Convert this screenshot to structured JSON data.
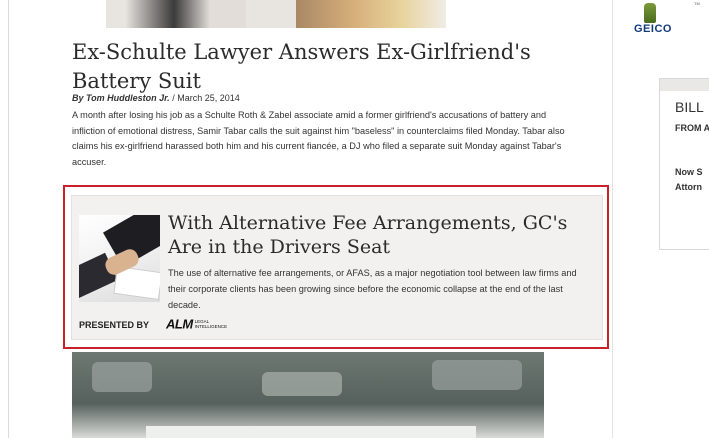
{
  "article": {
    "headline": "Ex-Schulte Lawyer Answers Ex-Girlfriend's Battery Suit",
    "author": "By Tom Huddleston Jr.",
    "date": "/ March 25, 2014",
    "summary": "A month after losing his job as a Schulte Roth & Zabel associate amid a former girlfriend's accusations of battery and infliction of emotional distress, Samir Tabar calls the suit against him \"baseless\" in counterclaims filed Monday. Tabar also claims his ex-girlfriend harassed both him and his current fiancée, a DJ who filed a separate suit Monday against Tabar's accuser."
  },
  "promo": {
    "title": "With Alternative Fee Arrangements, GC's Are in the Drivers Seat",
    "description": "The use of alternative fee arrangements, or AFAS, as a major negotiation tool between law firms and their corporate clients has been growing since before the economic collapse at the end of the last decade.",
    "presented_by": "PRESENTED BY",
    "sponsor_logo_main": "ALM",
    "sponsor_logo_sub": "LEGAL INTELLIGENCE",
    "highlight_color": "#c9202a"
  },
  "sidebar": {
    "ad_brand": "GEICO",
    "ad_mark": "TM",
    "box_title": "BILL",
    "box_subtitle": "FROM A",
    "box_line1": "Now S",
    "box_line2": "Attorn"
  },
  "icons": [
    "gecko-icon"
  ]
}
